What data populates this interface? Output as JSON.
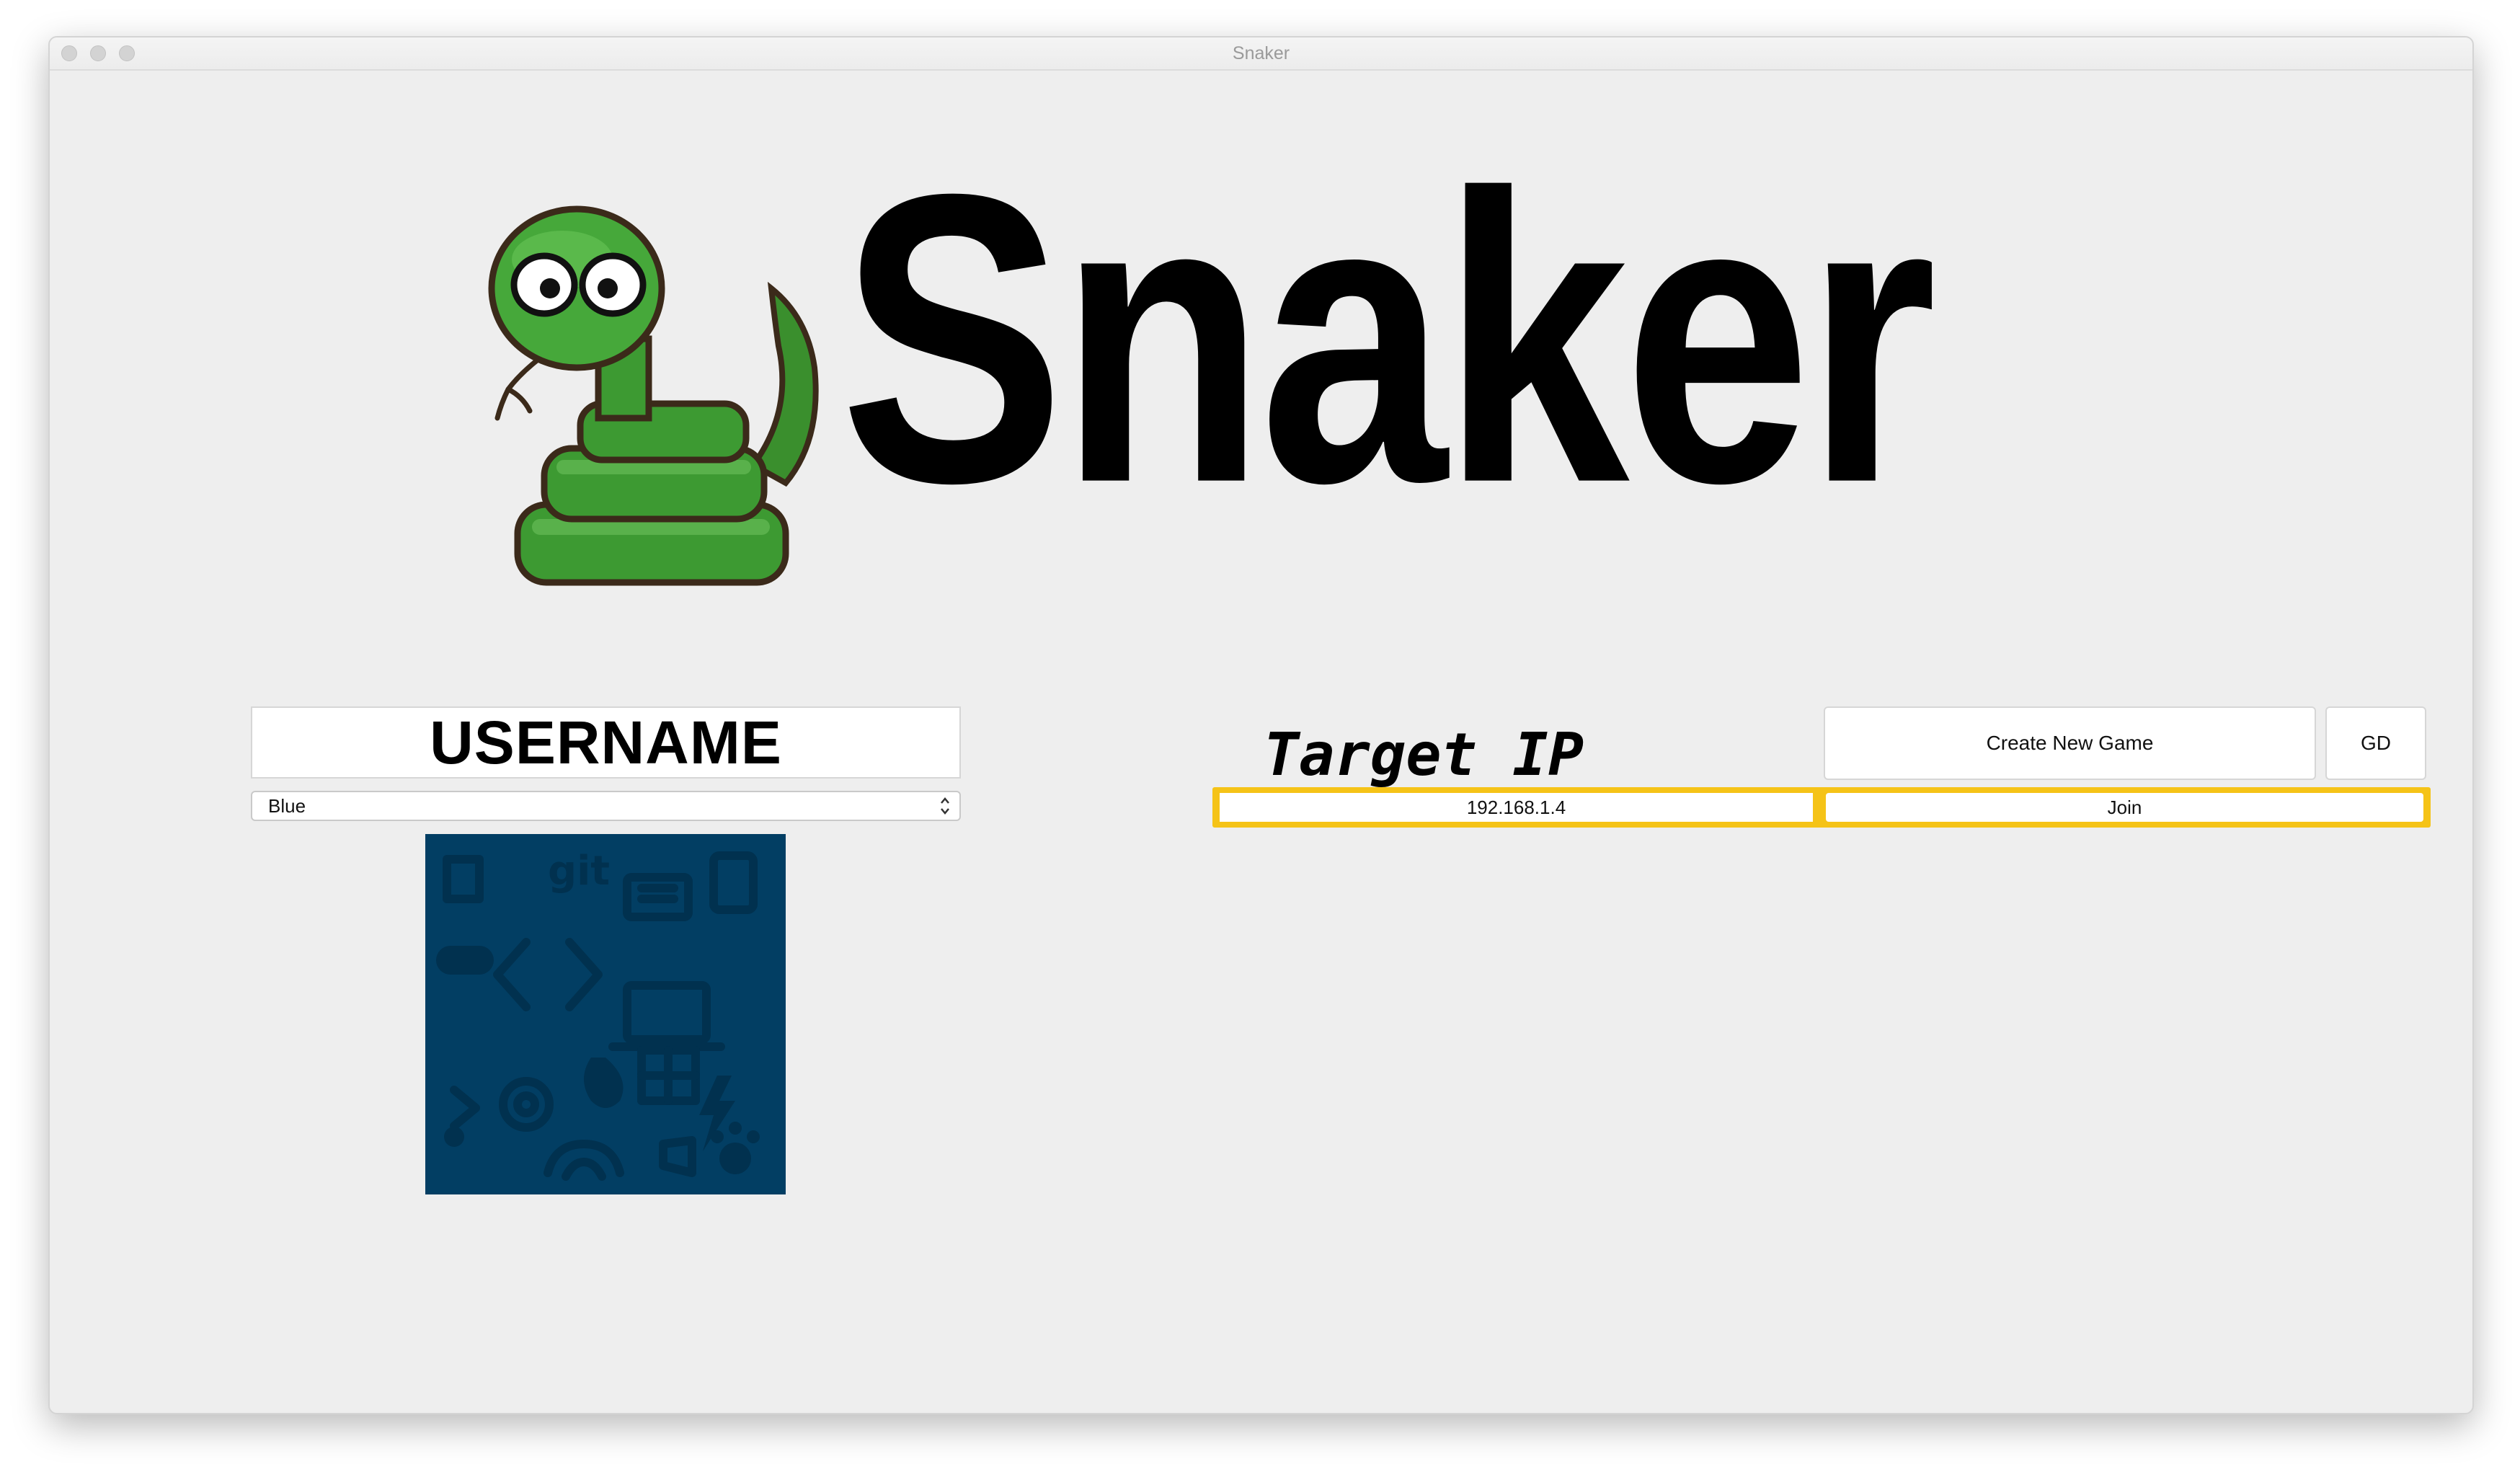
{
  "window": {
    "title": "Snaker"
  },
  "app": {
    "name": "Snaker",
    "logo_icon": "snake-mascot-icon"
  },
  "player": {
    "username_placeholder": "USERNAME",
    "color_selected": "Blue",
    "preview_color": "#023e63"
  },
  "network": {
    "target_ip_label": "Target IP",
    "ip_value": "192.168.1.4",
    "create_game_label": "Create New Game",
    "gd_label": "GD",
    "join_label": "Join",
    "focus_color": "#f5c317"
  }
}
